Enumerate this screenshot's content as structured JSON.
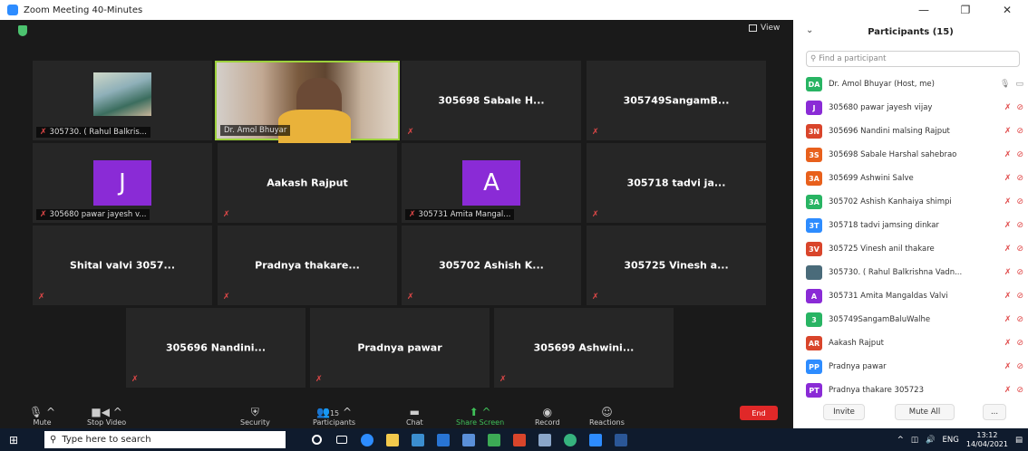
{
  "window": {
    "title": "Zoom Meeting 40-Minutes",
    "min": "—",
    "max": "❐",
    "close": "✕"
  },
  "meeting": {
    "view_label": "View"
  },
  "tiles": [
    {
      "name": "",
      "label": "305730. ( Rahul Balkris...",
      "kind": "photo"
    },
    {
      "name": "",
      "label": "Dr. Amol Bhuyar",
      "kind": "video"
    },
    {
      "name": "305698 Sabale H...",
      "label": "",
      "kind": "name"
    },
    {
      "name": "305749SangamB...",
      "label": "",
      "kind": "name"
    },
    {
      "name": "J",
      "label": "305680 pawar jayesh v...",
      "kind": "avatar",
      "color": "#8a2bd6"
    },
    {
      "name": "Aakash Rajput",
      "label": "",
      "kind": "name"
    },
    {
      "name": "A",
      "label": "305731 Amita Mangal...",
      "kind": "avatar",
      "color": "#8a2bd6"
    },
    {
      "name": "305718 tadvi ja...",
      "label": "",
      "kind": "name"
    },
    {
      "name": "Shital valvi 3057...",
      "label": "",
      "kind": "name"
    },
    {
      "name": "Pradnya thakare...",
      "label": "",
      "kind": "name"
    },
    {
      "name": "305702 Ashish K...",
      "label": "",
      "kind": "name"
    },
    {
      "name": "305725 Vinesh a...",
      "label": "",
      "kind": "name"
    },
    {
      "name": "305696 Nandini...",
      "label": "",
      "kind": "name"
    },
    {
      "name": "Pradnya pawar",
      "label": "",
      "kind": "name"
    },
    {
      "name": "305699 Ashwini...",
      "label": "",
      "kind": "name"
    }
  ],
  "toolbar": {
    "mute": "Mute",
    "stop_video": "Stop Video",
    "security": "Security",
    "participants": "Participants",
    "participants_count": "15",
    "chat": "Chat",
    "share_screen": "Share Screen",
    "record": "Record",
    "reactions": "Reactions",
    "end": "End"
  },
  "panel": {
    "title": "Participants (15)",
    "search_placeholder": "Find a participant",
    "invite": "Invite",
    "mute_all": "Mute All",
    "more": "...",
    "participants": [
      {
        "initials": "DA",
        "color": "#28b463",
        "name": "Dr. Amol Bhuyar (Host, me)",
        "host": true
      },
      {
        "initials": "J",
        "color": "#8a2bd6",
        "name": "305680 pawar jayesh vijay"
      },
      {
        "initials": "3N",
        "color": "#d9452b",
        "name": "305696 Nandini malsing Rajput"
      },
      {
        "initials": "3S",
        "color": "#e8601c",
        "name": "305698 Sabale Harshal sahebrao"
      },
      {
        "initials": "3A",
        "color": "#e8601c",
        "name": "305699 Ashwini Salve"
      },
      {
        "initials": "3A",
        "color": "#28b463",
        "name": "305702 Ashish Kanhaiya shimpi"
      },
      {
        "initials": "3T",
        "color": "#2d8cff",
        "name": "305718 tadvi jamsing dinkar"
      },
      {
        "initials": "3V",
        "color": "#d9452b",
        "name": "305725 Vinesh anil thakare"
      },
      {
        "initials": "",
        "color": "#4a6b7a",
        "name": "305730. ( Rahul Balkrishna Vadn..."
      },
      {
        "initials": "A",
        "color": "#8a2bd6",
        "name": "305731 Amita Mangaldas Valvi"
      },
      {
        "initials": "3",
        "color": "#28b463",
        "name": "305749SangamBaluWalhe"
      },
      {
        "initials": "AR",
        "color": "#d9452b",
        "name": "Aakash Rajput"
      },
      {
        "initials": "PP",
        "color": "#2d8cff",
        "name": "Pradnya pawar"
      },
      {
        "initials": "PT",
        "color": "#8a2bd6",
        "name": "Pradnya thakare 305723"
      }
    ]
  },
  "taskbar": {
    "search_placeholder": "Type here to search",
    "lang": "ENG",
    "time": "13:12",
    "date": "14/04/2021"
  }
}
